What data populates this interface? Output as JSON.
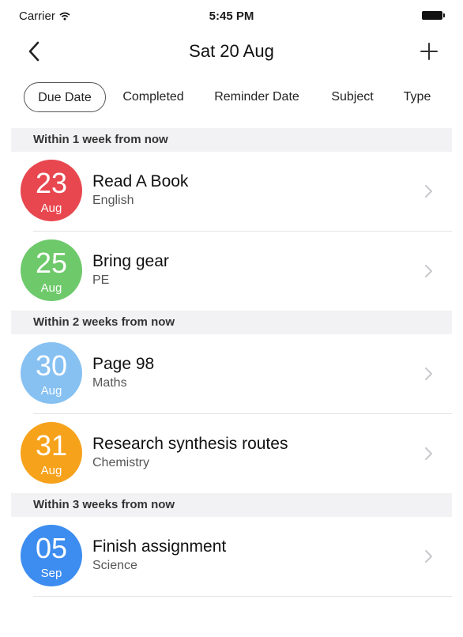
{
  "status_bar": {
    "carrier": "Carrier",
    "time": "5:45 PM"
  },
  "nav": {
    "title": "Sat 20 Aug"
  },
  "filters": [
    {
      "label": "Due Date",
      "active": true
    },
    {
      "label": "Completed",
      "active": false
    },
    {
      "label": "Reminder Date",
      "active": false
    },
    {
      "label": "Subject",
      "active": false
    },
    {
      "label": "Type",
      "active": false
    }
  ],
  "sections": [
    {
      "header": "Within 1 week from now",
      "items": [
        {
          "day": "23",
          "month": "Aug",
          "title": "Read A Book",
          "subject": "English",
          "color": "#e8474f"
        },
        {
          "day": "25",
          "month": "Aug",
          "title": "Bring gear",
          "subject": "PE",
          "color": "#6ec96a"
        }
      ]
    },
    {
      "header": "Within 2 weeks from now",
      "items": [
        {
          "day": "30",
          "month": "Aug",
          "title": "Page 98",
          "subject": "Maths",
          "color": "#86c1f2"
        },
        {
          "day": "31",
          "month": "Aug",
          "title": "Research synthesis routes",
          "subject": "Chemistry",
          "color": "#f7a21b"
        }
      ]
    },
    {
      "header": "Within 3 weeks from now",
      "items": [
        {
          "day": "05",
          "month": "Sep",
          "title": "Finish assignment",
          "subject": "Science",
          "color": "#3d8df0"
        }
      ]
    }
  ]
}
